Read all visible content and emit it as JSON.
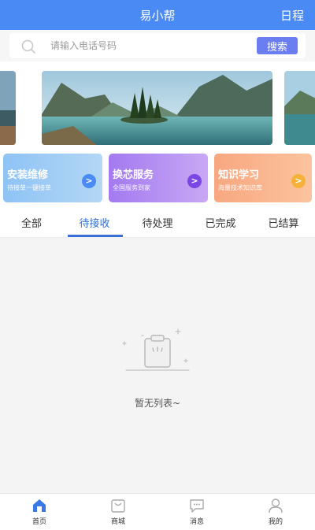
{
  "header": {
    "title": "易小帮",
    "schedule_label": "日程"
  },
  "search": {
    "placeholder": "请输入电话号码",
    "button_label": "搜索"
  },
  "cards": [
    {
      "title": "安装维修",
      "subtitle": "待接单一键接单",
      "arrow": ">"
    },
    {
      "title": "换芯服务",
      "subtitle": "全国服务到家",
      "arrow": ">"
    },
    {
      "title": "知识学习",
      "subtitle": "海量技术知识库",
      "arrow": ">"
    }
  ],
  "tabs": [
    {
      "label": "全部"
    },
    {
      "label": "待接收"
    },
    {
      "label": "待处理"
    },
    {
      "label": "已完成"
    },
    {
      "label": "已结算"
    }
  ],
  "active_tab": "待接收",
  "empty": {
    "text": "暂无列表~"
  },
  "tabbar": [
    {
      "label": "首页",
      "icon": "home-icon"
    },
    {
      "label": "商城",
      "icon": "shop-icon"
    },
    {
      "label": "消息",
      "icon": "message-icon"
    },
    {
      "label": "我的",
      "icon": "profile-icon"
    }
  ],
  "colors": {
    "header": "#4a8af4",
    "search_button": "#6a7df1",
    "active_tab": "#2d6fd6",
    "tabbar_active": "#3b78e7"
  }
}
